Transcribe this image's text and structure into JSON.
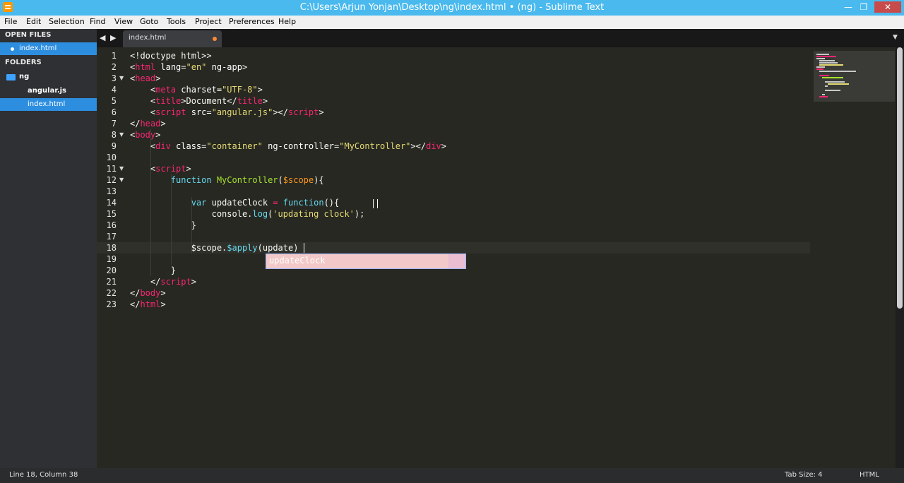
{
  "window": {
    "title": "C:\\Users\\Arjun Yonjan\\Desktop\\ng\\index.html • (ng) - Sublime Text",
    "minimize_glyph": "—",
    "maximize_glyph": "❐",
    "close_glyph": "✕"
  },
  "menu": [
    "File",
    "Edit",
    "Selection",
    "Find",
    "View",
    "Goto",
    "Tools",
    "Project",
    "Preferences",
    "Help"
  ],
  "sidebar": {
    "open_files_header": "OPEN FILES",
    "open_files": [
      "index.html"
    ],
    "folders_header": "FOLDERS",
    "folder": "ng",
    "files": [
      "angular.js",
      "index.html"
    ]
  },
  "tabs": {
    "back_glyph": "◀",
    "forward_glyph": "▶",
    "active_tab": "index.html",
    "overflow_glyph": "▼"
  },
  "editor": {
    "line_numbers": [
      "1",
      "2",
      "3",
      "4",
      "5",
      "6",
      "7",
      "8",
      "9",
      "10",
      "11",
      "12",
      "13",
      "14",
      "15",
      "16",
      "17",
      "18",
      "19",
      "20",
      "21",
      "22",
      "23"
    ],
    "fold_marker": "▼",
    "lines": [
      [
        [
          "<!doctype html>",
          "plain"
        ],
        [
          ">",
          "plain"
        ]
      ],
      [
        [
          "<",
          "plain"
        ],
        [
          "html",
          "tag"
        ],
        [
          " lang=",
          "attr"
        ],
        [
          "\"en\"",
          "str"
        ],
        [
          " ng-app",
          "attr"
        ],
        [
          ">",
          "plain"
        ]
      ],
      [
        [
          "<",
          "plain"
        ],
        [
          "head",
          "tag"
        ],
        [
          ">",
          "plain"
        ]
      ],
      [
        [
          "    <",
          "plain"
        ],
        [
          "meta",
          "tag"
        ],
        [
          " charset=",
          "attr"
        ],
        [
          "\"UTF-8\"",
          "str"
        ],
        [
          ">",
          "plain"
        ]
      ],
      [
        [
          "    <",
          "plain"
        ],
        [
          "title",
          "tag"
        ],
        [
          ">Document</",
          "plain"
        ],
        [
          "title",
          "tag"
        ],
        [
          ">",
          "plain"
        ]
      ],
      [
        [
          "    <",
          "plain"
        ],
        [
          "script",
          "tag"
        ],
        [
          " src=",
          "attr"
        ],
        [
          "\"angular.js\"",
          "str"
        ],
        [
          "></",
          "plain"
        ],
        [
          "script",
          "tag"
        ],
        [
          ">",
          "plain"
        ]
      ],
      [
        [
          "</",
          "plain"
        ],
        [
          "head",
          "tag"
        ],
        [
          ">",
          "plain"
        ]
      ],
      [
        [
          "<",
          "plain"
        ],
        [
          "body",
          "tag"
        ],
        [
          ">",
          "plain"
        ]
      ],
      [
        [
          "    <",
          "plain"
        ],
        [
          "div",
          "tag"
        ],
        [
          " class=",
          "attr"
        ],
        [
          "\"container\"",
          "str"
        ],
        [
          " ng-controller=",
          "attr"
        ],
        [
          "\"MyController\"",
          "str"
        ],
        [
          "></",
          "plain"
        ],
        [
          "div",
          "tag"
        ],
        [
          ">",
          "plain"
        ]
      ],
      [],
      [
        [
          "    <",
          "plain"
        ],
        [
          "script",
          "tag"
        ],
        [
          ">",
          "plain"
        ]
      ],
      [
        [
          "        ",
          "plain"
        ],
        [
          "function",
          "kw"
        ],
        [
          " ",
          "plain"
        ],
        [
          "MyController",
          "fn"
        ],
        [
          "(",
          "plain"
        ],
        [
          "$scope",
          "var"
        ],
        [
          "){",
          "plain"
        ]
      ],
      [],
      [
        [
          "            ",
          "plain"
        ],
        [
          "var",
          "kw"
        ],
        [
          " updateClock ",
          "plain"
        ],
        [
          "=",
          "op"
        ],
        [
          " ",
          "plain"
        ],
        [
          "function",
          "kw"
        ],
        [
          "(){",
          "plain"
        ]
      ],
      [
        [
          "                console.",
          "plain"
        ],
        [
          "log",
          "kw"
        ],
        [
          "(",
          "plain"
        ],
        [
          "'updating clock'",
          "str"
        ],
        [
          ");",
          "plain"
        ]
      ],
      [
        [
          "            }",
          "plain"
        ]
      ],
      [],
      [
        [
          "            $scope.",
          "plain"
        ],
        [
          "$apply",
          "kw"
        ],
        [
          "(update)",
          "plain"
        ]
      ],
      [],
      [
        [
          "        }",
          "plain"
        ]
      ],
      [
        [
          "    </",
          "plain"
        ],
        [
          "script",
          "tag"
        ],
        [
          ">",
          "plain"
        ]
      ],
      [
        [
          "</",
          "plain"
        ],
        [
          "body",
          "tag"
        ],
        [
          ">",
          "plain"
        ]
      ],
      [
        [
          "</",
          "plain"
        ],
        [
          "html",
          "tag"
        ],
        [
          ">",
          "plain"
        ]
      ]
    ],
    "autocomplete_suggestion": "updateClock"
  },
  "status": {
    "position": "Line 18, Column 38",
    "tab_size": "Tab Size: 4",
    "syntax": "HTML"
  }
}
